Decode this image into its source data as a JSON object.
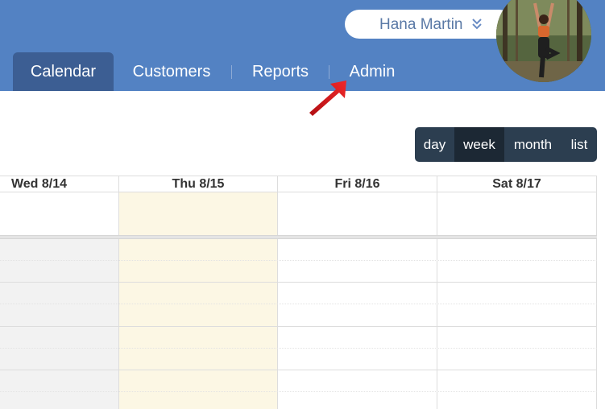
{
  "header": {
    "user_name": "Hana Martin",
    "nav": [
      {
        "label": "Calendar",
        "active": true
      },
      {
        "label": "Customers",
        "active": false
      },
      {
        "label": "Reports",
        "active": false
      },
      {
        "label": "Admin",
        "active": false
      }
    ]
  },
  "view_switch": {
    "options": [
      "day",
      "week",
      "month",
      "list"
    ],
    "selected": "week"
  },
  "calendar": {
    "columns": [
      {
        "label": "Wed 8/14",
        "today": false,
        "past": true
      },
      {
        "label": "Thu 8/15",
        "today": true,
        "past": false
      },
      {
        "label": "Fri 8/16",
        "today": false,
        "past": false
      },
      {
        "label": "Sat 8/17",
        "today": false,
        "past": false
      }
    ]
  },
  "colors": {
    "header_bg": "#5382c3",
    "active_tab": "#3c5e93",
    "today_bg": "#fcf7e4",
    "past_bg": "#f2f2f2",
    "switch_bg": "#2c3e50",
    "switch_active": "#1c2834",
    "arrow": "#e8191c"
  },
  "icons": {
    "user_menu": "double-chevron-down-icon",
    "pointer": "red-arrow-icon"
  }
}
